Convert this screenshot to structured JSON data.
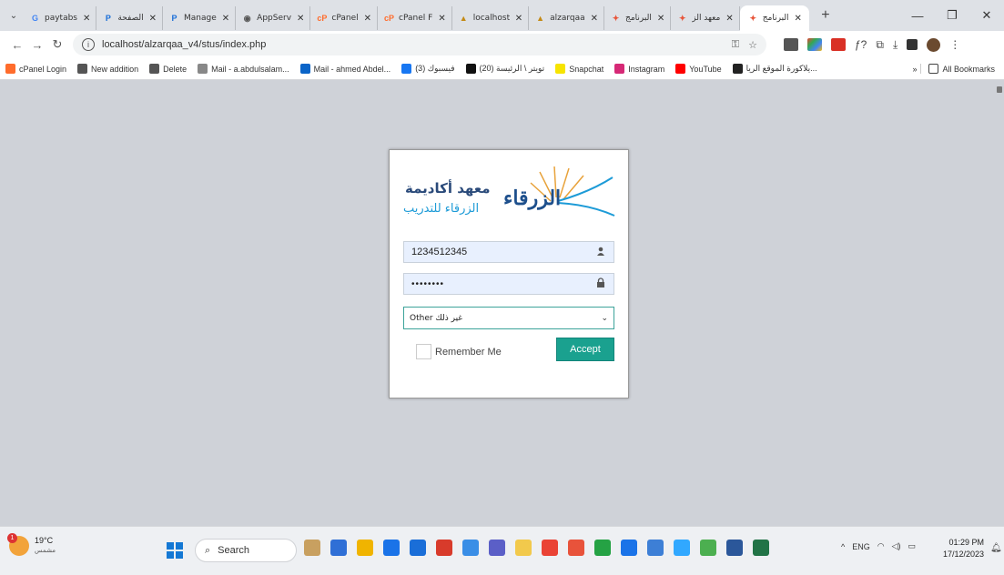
{
  "browser": {
    "tabs": [
      {
        "title": "paytabs",
        "fav_color": "#4285f4",
        "fav_glyph": "G"
      },
      {
        "title": "الصفحة",
        "fav_color": "#1a6ed8",
        "fav_glyph": "P"
      },
      {
        "title": "Manage",
        "fav_color": "#1a6ed8",
        "fav_glyph": "P"
      },
      {
        "title": "AppServ",
        "fav_color": "#555555",
        "fav_glyph": "◉"
      },
      {
        "title": "cPanel",
        "fav_color": "#ff6c2c",
        "fav_glyph": "cP"
      },
      {
        "title": "cPanel F",
        "fav_color": "#ff6c2c",
        "fav_glyph": "cP"
      },
      {
        "title": "localhost",
        "fav_color": "#c48a16",
        "fav_glyph": "▲"
      },
      {
        "title": "alzarqaa",
        "fav_color": "#c48a16",
        "fav_glyph": "▲"
      },
      {
        "title": "البرنامج",
        "fav_color": "#e8553a",
        "fav_glyph": "✦"
      },
      {
        "title": "معهد الز",
        "fav_color": "#e8553a",
        "fav_glyph": "✦"
      }
    ],
    "active_tab": {
      "title": "البرنامج",
      "fav_color": "#e8553a",
      "fav_glyph": "✦"
    },
    "url": "localhost/alzarqaa_v4/stus/index.php",
    "bookmarks": [
      {
        "label": "cPanel Login",
        "color": "#ff6c2c"
      },
      {
        "label": "New addition",
        "color": "#555555"
      },
      {
        "label": "Delete",
        "color": "#555555"
      },
      {
        "label": "Mail - a.abdulsalam...",
        "color": "#888888"
      },
      {
        "label": "Mail - ahmed Abdel...",
        "color": "#0a64c8"
      },
      {
        "label": "(3) فيسبوك",
        "color": "#1877f2"
      },
      {
        "label": "(20) تويتر \\ الرئيسة",
        "color": "#111111"
      },
      {
        "label": "Snapchat",
        "color": "#f7e400"
      },
      {
        "label": "Instagram",
        "color": "#d62976"
      },
      {
        "label": "YouTube",
        "color": "#ff0000"
      },
      {
        "label": "يلاكورة الموقع الريا...",
        "color": "#222222"
      }
    ],
    "all_bookmarks": "All Bookmarks",
    "more_chevron": "»"
  },
  "login": {
    "logo_line1": "معهد أكاديمة",
    "logo_line2": "الزرقاء للتدريب",
    "logo_mark": "الزرقاء",
    "username_value": "1234512345",
    "password_value": "••••••••",
    "select_value": "Other غير ذلك",
    "remember_label": "Remember Me",
    "accept_label": "Accept"
  },
  "taskbar": {
    "weather_temp": "19°C",
    "weather_cond": "مشمس",
    "weather_badge": "1",
    "search_label": "Search",
    "lang": "ENG",
    "time": "01:29 PM",
    "date": "17/12/2023",
    "app_colors": [
      "#c8a060",
      "#2f6fd6",
      "#f0b400",
      "#1a73e8",
      "#1a6ed8",
      "#d83b2b",
      "#3a8ee6",
      "#5b5fc7",
      "#f2c94c",
      "#ea4335",
      "#e8533b",
      "#25a244",
      "#1a73e8",
      "#3d7fd6",
      "#31a8ff",
      "#4caf50",
      "#2b579a",
      "#217346"
    ]
  }
}
